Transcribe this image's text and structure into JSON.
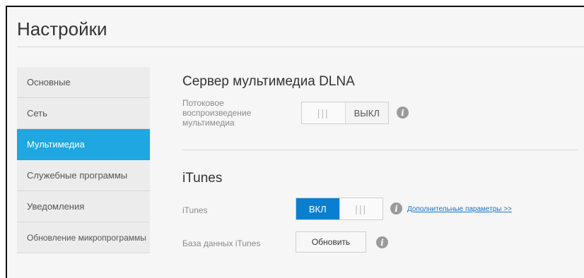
{
  "page": {
    "title": "Настройки"
  },
  "sidebar": {
    "items": [
      {
        "label": "Основные"
      },
      {
        "label": "Сеть"
      },
      {
        "label": "Мультимедиа"
      },
      {
        "label": "Служебные программы"
      },
      {
        "label": "Уведомления"
      },
      {
        "label": "Обновление микропрограммы"
      }
    ],
    "active_index": 2
  },
  "dlna": {
    "title": "Сервер мультимедиа DLNA",
    "streaming_label_lines": [
      "Потоковое",
      "воспроизведение",
      "мультимедиа"
    ],
    "toggle": {
      "state": "off",
      "grip": "|||",
      "label": "ВЫКЛ"
    },
    "info_icon": "info-icon"
  },
  "itunes": {
    "title": "iTunes",
    "itunes_label": "iTunes",
    "toggle": {
      "state": "on",
      "label": "ВКЛ",
      "grip": "|||"
    },
    "more_link": "Дополнительные параметры >>",
    "db_label": "База данных iTunes",
    "refresh_button": "Обновить"
  },
  "colors": {
    "accent": "#1ea7e1",
    "toggle_on": "#0a7fd0",
    "link": "#1a73c9"
  }
}
